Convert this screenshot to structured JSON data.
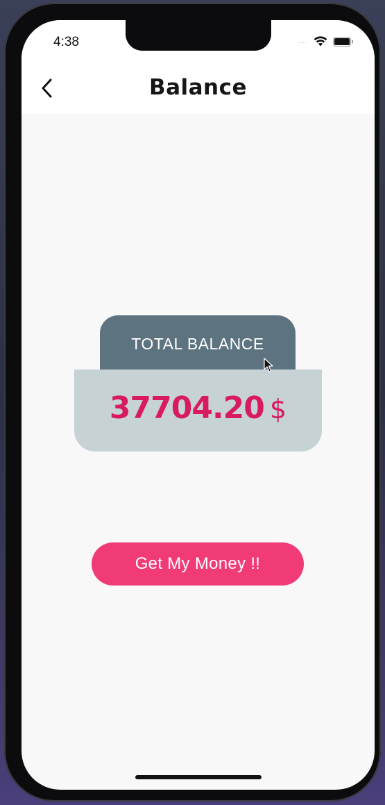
{
  "status_bar": {
    "time": "4:38",
    "signal": "....",
    "icons": [
      "signal-dots-icon",
      "wifi-icon",
      "battery-icon"
    ]
  },
  "nav": {
    "back_icon": "chevron-left-icon",
    "title": "Balance"
  },
  "balance": {
    "label": "TOTAL BALANCE",
    "amount": "37704.20",
    "currency": "$"
  },
  "action": {
    "label": "Get My Money !!"
  },
  "colors": {
    "tab": "#5d7380",
    "card": "#c7d2d5",
    "amount": "#d81b5e",
    "button": "#f03b77",
    "background": "#f8f8f8"
  }
}
